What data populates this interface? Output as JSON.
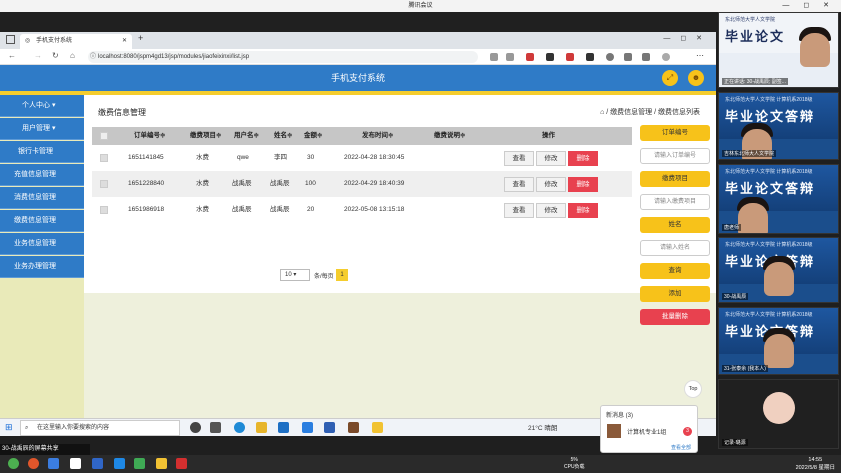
{
  "meeting": {
    "title": "腾讯会议",
    "window_controls": "— ◻ ✕",
    "share_label": "30-战禹辰的屏幕共享",
    "clock_time": "14:55",
    "clock_date": "2022/5/8 星期日",
    "battery": "5%",
    "battery_label": "CPU负载",
    "participants": [
      {
        "name": "正在讲话: 30-战禹辰; 副签...",
        "banner_line1": "东北师范大学人文学院",
        "banner_line2": "毕业论文"
      },
      {
        "name": "吉林东北师大人文学院",
        "banner_line1": "东北师范大学人文学院 计算机系2018级",
        "banner_line2": "毕业论文答辩"
      },
      {
        "name": "唐老师",
        "banner_line1": "东北师范大学人文学院 计算机系2018级",
        "banner_line2": "毕业论文答辩"
      },
      {
        "name": "30-战禹辰",
        "banner_line1": "东北师范大学人文学院 计算机系2018级",
        "banner_line2": "毕业论文答辩"
      },
      {
        "name": "31-张泰余 (我本人)",
        "banner_line1": "东北师范大学人文学院 计算机系2018级",
        "banner_line2": "毕业论文答辩"
      },
      {
        "name": "记录-璐源"
      }
    ]
  },
  "browser": {
    "tab_title": "手机支付系统",
    "new_tab": "+",
    "url": "localhost:8080/jspm4gd13/jsp/modules/jiaofeixinxi/list.jsp",
    "window_controls": "—  ◻  ✕"
  },
  "app": {
    "title": "手机支付系统",
    "sidebar": [
      {
        "label": "个人中心"
      },
      {
        "label": "用户管理"
      },
      {
        "label": "银行卡管理"
      },
      {
        "label": "充值信息管理"
      },
      {
        "label": "消费信息管理"
      },
      {
        "label": "缴费信息管理"
      },
      {
        "label": "业务信息管理"
      },
      {
        "label": "业务办理管理"
      }
    ],
    "page_title": "缴费信息管理",
    "breadcrumb": "⌂ / 缴费信息管理 / 缴费信息列表",
    "columns": [
      "订单编号≑",
      "缴费项目≑",
      "用户名≑",
      "姓名≑",
      "金额≑",
      "发布时间≑",
      "缴费说明≑",
      "操作"
    ],
    "rows": [
      {
        "order_no": "1651141845",
        "item": "水费",
        "username": "qwe",
        "name": "李四",
        "amount": "30",
        "time": "2022-04-28 18:30:45",
        "note": ""
      },
      {
        "order_no": "1651228840",
        "item": "水费",
        "username": "战禹辰",
        "name": "战禹辰",
        "amount": "100",
        "time": "2022-04-29 18:40:39",
        "note": ""
      },
      {
        "order_no": "1651986918",
        "item": "水费",
        "username": "战禹辰",
        "name": "战禹辰",
        "amount": "20",
        "time": "2022-05-08 13:15:18",
        "note": ""
      }
    ],
    "actions": {
      "view": "查看",
      "edit": "修改",
      "delete": "删除"
    },
    "pager": {
      "page_size": "10",
      "per_page_label": "条/每页",
      "current_page": "1"
    },
    "filters": {
      "order_label": "订单编号",
      "order_placeholder": "请输入订单编号",
      "item_label": "缴费项目",
      "item_placeholder": "请输入缴费项目",
      "name_label": "姓名",
      "name_placeholder": "请输入姓名",
      "query": "查询",
      "add": "添加",
      "batch_delete": "批量删除"
    },
    "top_button": "Top"
  },
  "taskbar": {
    "search_placeholder": "在这里输入你要搜索的内容",
    "weather": "21°C 晴朗"
  },
  "notification": {
    "title": "新消息 (3)",
    "group": "计算机专业1组",
    "count": "3",
    "view_all": "查看全部"
  }
}
